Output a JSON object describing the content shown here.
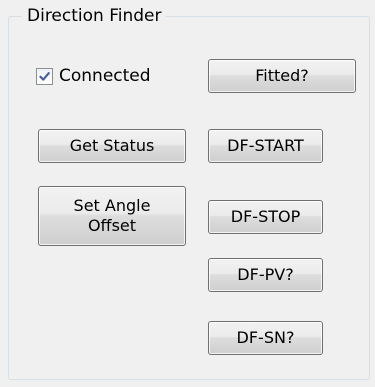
{
  "group": {
    "title": "Direction Finder"
  },
  "connected": {
    "label": "Connected",
    "checked": true
  },
  "buttons": {
    "fitted": "Fitted?",
    "get_status": "Get Status",
    "set_angle_offset": "Set Angle\nOffset",
    "df_start": "DF-START",
    "df_stop": "DF-STOP",
    "df_pv": "DF-PV?",
    "df_sn": "DF-SN?"
  },
  "icons": {
    "check": "check-mark-icon"
  }
}
